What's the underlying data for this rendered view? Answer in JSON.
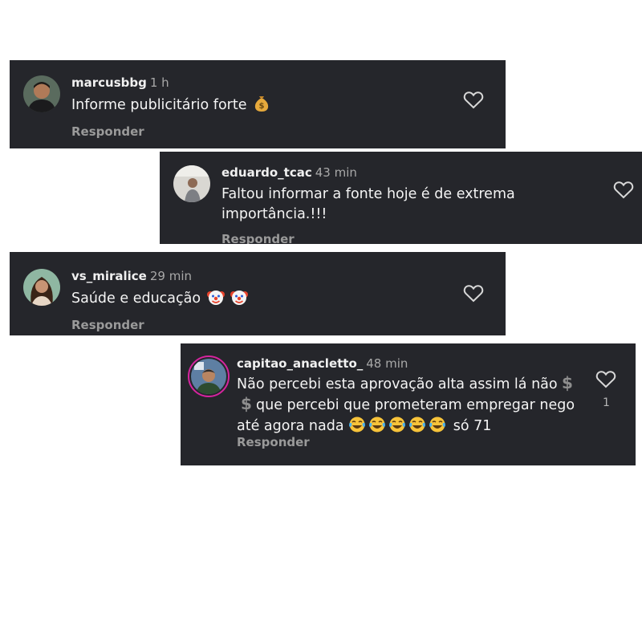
{
  "comments": [
    {
      "username": "marcusbbg",
      "time": "1 h",
      "text": "Informe publicitário forte",
      "text_emoji": "money-bag",
      "reply_label": "Responder"
    },
    {
      "username": "eduardo_tcac",
      "time": "43 min",
      "text_line1": "Faltou informar a fonte hoje é de extrema",
      "text_line2": "importância.!!!",
      "reply_label": "Responder"
    },
    {
      "username": "vs_miralice",
      "time": "29 min",
      "text": "Saúde e educação",
      "text_emoji": "clown-face x2",
      "reply_label": "Responder"
    },
    {
      "username": "capitao_anacletto_",
      "time": "48 min",
      "text_part1": "Não percebi esta aprovação alta assim lá não",
      "text_part2": "que percebi que prometeram empregar nego",
      "text_part3": "até agora nada",
      "text_part4": "só 71",
      "text_emoji": "dollar-sign x2, tears-of-joy x5",
      "reply_label": "Responder",
      "like_count": "1"
    }
  ],
  "colors": {
    "card_background": "#25262b",
    "username": "#f0f0f0",
    "timestamp": "#a8a8a8",
    "reply": "#9a9a9a",
    "story_ring": "#d6249f"
  }
}
